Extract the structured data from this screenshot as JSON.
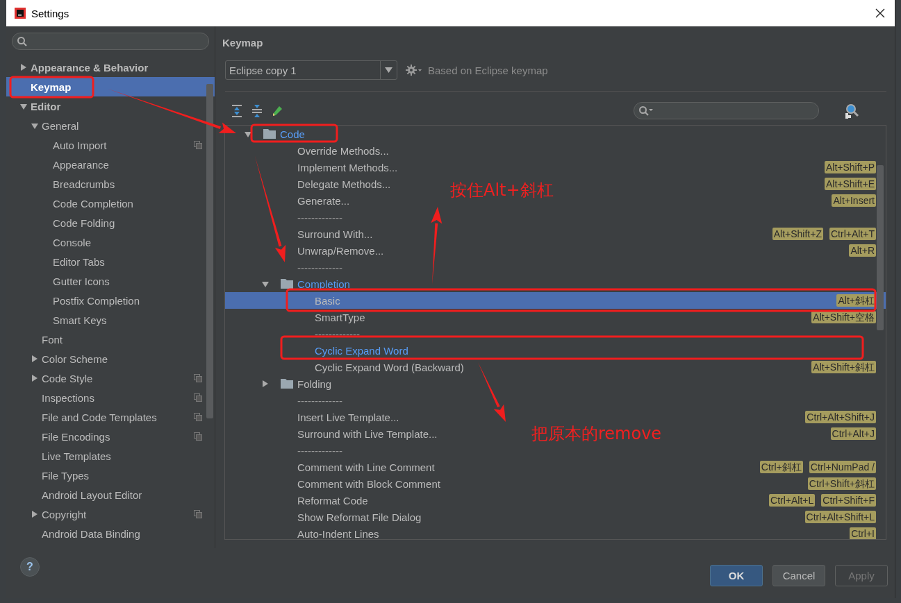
{
  "window": {
    "title": "Settings"
  },
  "sidebar": {
    "items": [
      {
        "label": "Appearance & Behavior",
        "expanded": false,
        "selected": false,
        "per_project": false
      },
      {
        "label": "Keymap",
        "selected": true,
        "per_project": false
      },
      {
        "label": "Editor",
        "expanded": true,
        "selected": false,
        "per_project": false,
        "children": [
          {
            "label": "General",
            "expanded": true,
            "selected": false,
            "per_project": false,
            "children": [
              {
                "label": "Auto Import",
                "selected": false,
                "per_project": true
              },
              {
                "label": "Appearance",
                "selected": false,
                "per_project": false
              },
              {
                "label": "Breadcrumbs",
                "selected": false,
                "per_project": false
              },
              {
                "label": "Code Completion",
                "selected": false,
                "per_project": false
              },
              {
                "label": "Code Folding",
                "selected": false,
                "per_project": false
              },
              {
                "label": "Console",
                "selected": false,
                "per_project": false
              },
              {
                "label": "Editor Tabs",
                "selected": false,
                "per_project": false
              },
              {
                "label": "Gutter Icons",
                "selected": false,
                "per_project": false
              },
              {
                "label": "Postfix Completion",
                "selected": false,
                "per_project": false
              },
              {
                "label": "Smart Keys",
                "selected": false,
                "per_project": false
              }
            ]
          },
          {
            "label": "Font",
            "selected": false,
            "per_project": false
          },
          {
            "label": "Color Scheme",
            "expanded": false,
            "selected": false,
            "per_project": false
          },
          {
            "label": "Code Style",
            "expanded": false,
            "selected": false,
            "per_project": true
          },
          {
            "label": "Inspections",
            "selected": false,
            "per_project": true
          },
          {
            "label": "File and Code Templates",
            "selected": false,
            "per_project": true
          },
          {
            "label": "File Encodings",
            "selected": false,
            "per_project": true
          },
          {
            "label": "Live Templates",
            "selected": false,
            "per_project": false
          },
          {
            "label": "File Types",
            "selected": false,
            "per_project": false
          },
          {
            "label": "Android Layout Editor",
            "selected": false,
            "per_project": false
          },
          {
            "label": "Copyright",
            "expanded": false,
            "selected": false,
            "per_project": true
          },
          {
            "label": "Android Data Binding",
            "selected": false,
            "per_project": false
          }
        ]
      }
    ]
  },
  "keymap": {
    "heading": "Keymap",
    "scheme": "Eclipse copy 1",
    "based_on": "Based on Eclipse keymap",
    "tree": [
      {
        "kind": "folder",
        "label": "Code",
        "expanded": true,
        "modified": true,
        "selected": false,
        "children": [
          {
            "kind": "action",
            "label": "Override Methods...",
            "modified": false,
            "selected": false
          },
          {
            "kind": "action",
            "label": "Implement Methods...",
            "modified": false,
            "selected": false,
            "shortcuts": [
              "Alt+Shift+P"
            ]
          },
          {
            "kind": "action",
            "label": "Delegate Methods...",
            "modified": false,
            "selected": false,
            "shortcuts": [
              "Alt+Shift+E"
            ]
          },
          {
            "kind": "action",
            "label": "Generate...",
            "modified": false,
            "selected": false,
            "shortcuts": [
              "Alt+Insert"
            ]
          },
          {
            "kind": "separator",
            "label": "-------------"
          },
          {
            "kind": "action",
            "label": "Surround With...",
            "modified": false,
            "selected": false,
            "shortcuts": [
              "Alt+Shift+Z",
              "Ctrl+Alt+T"
            ]
          },
          {
            "kind": "action",
            "label": "Unwrap/Remove...",
            "modified": false,
            "selected": false,
            "shortcuts": [
              "Alt+R"
            ]
          },
          {
            "kind": "separator",
            "label": "-------------"
          },
          {
            "kind": "folder",
            "label": "Completion",
            "expanded": true,
            "modified": true,
            "selected": false,
            "children": [
              {
                "kind": "action",
                "label": "Basic",
                "modified": false,
                "selected": true,
                "shortcuts": [
                  "Alt+斜杠"
                ]
              },
              {
                "kind": "action",
                "label": "SmartType",
                "modified": false,
                "selected": false,
                "shortcuts": [
                  "Alt+Shift+空格"
                ]
              },
              {
                "kind": "separator",
                "label": "-------------"
              },
              {
                "kind": "action",
                "label": "Cyclic Expand Word",
                "modified": true,
                "selected": false
              },
              {
                "kind": "action",
                "label": "Cyclic Expand Word (Backward)",
                "modified": false,
                "selected": false,
                "shortcuts": [
                  "Alt+Shift+斜杠"
                ]
              }
            ]
          },
          {
            "kind": "folder",
            "label": "Folding",
            "expanded": false,
            "modified": false,
            "selected": false
          },
          {
            "kind": "separator",
            "label": "-------------"
          },
          {
            "kind": "action",
            "label": "Insert Live Template...",
            "modified": false,
            "selected": false,
            "shortcuts": [
              "Ctrl+Alt+Shift+J"
            ]
          },
          {
            "kind": "action",
            "label": "Surround with Live Template...",
            "modified": false,
            "selected": false,
            "shortcuts": [
              "Ctrl+Alt+J"
            ]
          },
          {
            "kind": "separator",
            "label": "-------------"
          },
          {
            "kind": "action",
            "label": "Comment with Line Comment",
            "modified": false,
            "selected": false,
            "shortcuts": [
              "Ctrl+斜杠",
              "Ctrl+NumPad /"
            ]
          },
          {
            "kind": "action",
            "label": "Comment with Block Comment",
            "modified": false,
            "selected": false,
            "shortcuts": [
              "Ctrl+Shift+斜杠"
            ]
          },
          {
            "kind": "action",
            "label": "Reformat Code",
            "modified": false,
            "selected": false,
            "shortcuts": [
              "Ctrl+Alt+L",
              "Ctrl+Shift+F"
            ]
          },
          {
            "kind": "action",
            "label": "Show Reformat File Dialog",
            "modified": false,
            "selected": false,
            "shortcuts": [
              "Ctrl+Alt+Shift+L"
            ]
          },
          {
            "kind": "action",
            "label": "Auto-Indent Lines",
            "modified": false,
            "selected": false,
            "shortcuts": [
              "Ctrl+I"
            ]
          }
        ]
      }
    ]
  },
  "footer": {
    "help": "?",
    "buttons": [
      {
        "label": "OK",
        "default": true,
        "disabled": false
      },
      {
        "label": "Cancel",
        "default": false,
        "disabled": false
      },
      {
        "label": "Apply",
        "default": false,
        "disabled": true
      }
    ]
  },
  "annotations": {
    "notes": [
      "按住Alt+斜杠",
      "把原本的remove"
    ]
  }
}
